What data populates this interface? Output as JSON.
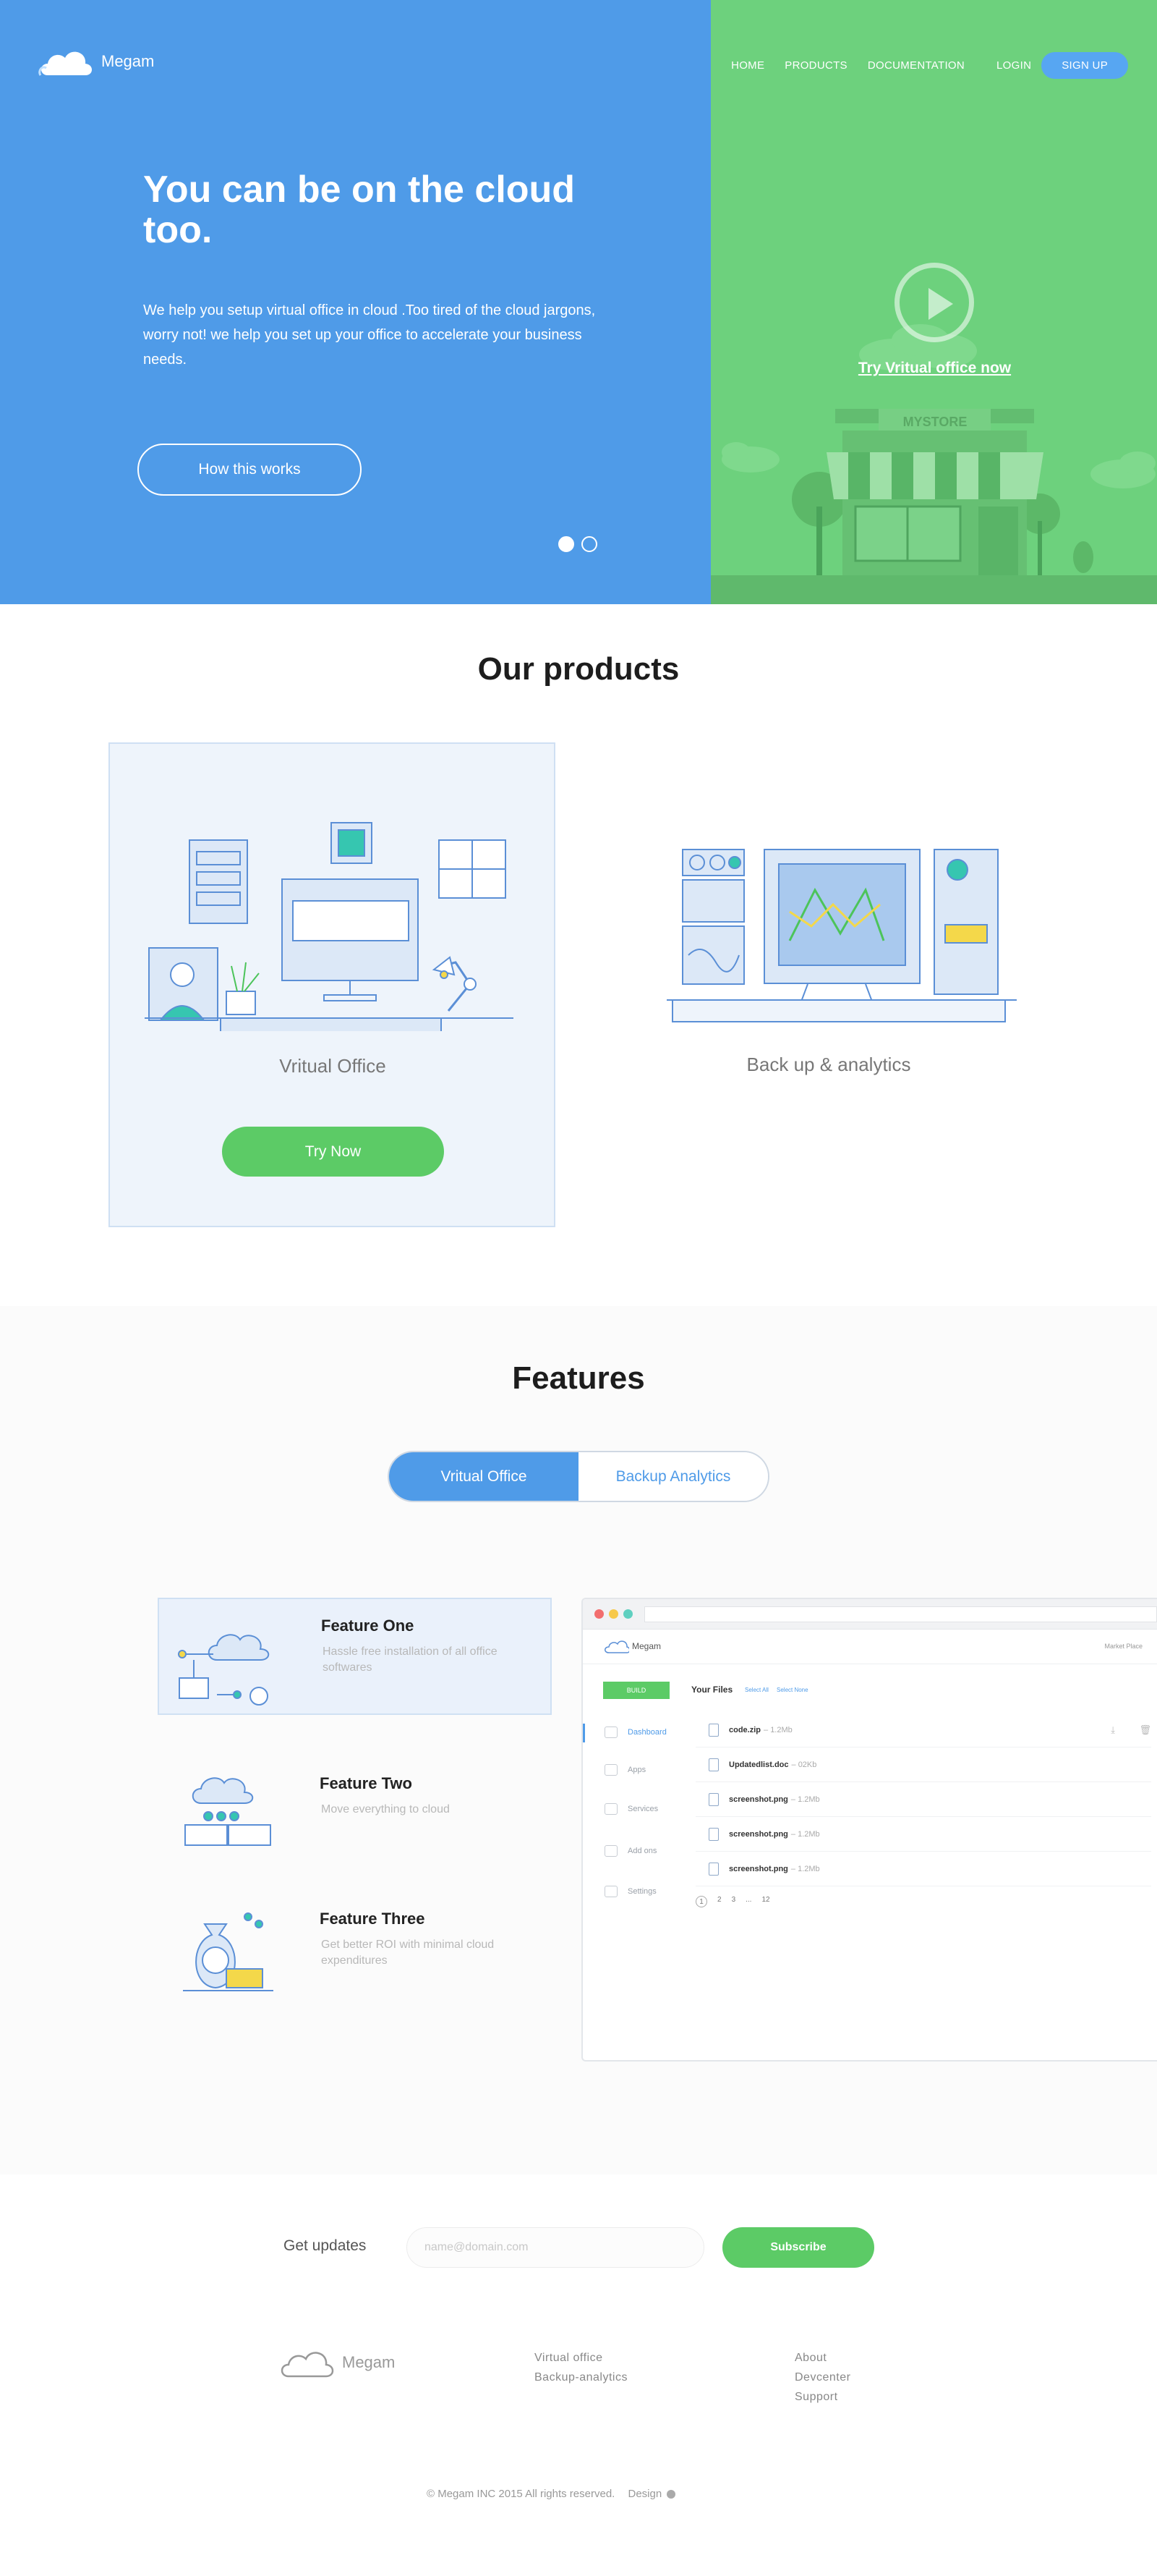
{
  "brand": {
    "name": "Megam"
  },
  "nav": {
    "home": "HOME",
    "products": "PRODUCTS",
    "documentation": "DOCUMENTATION",
    "login": "LOGIN",
    "signup": "SIGN UP"
  },
  "hero": {
    "title": "You can be on the cloud too.",
    "description": "We help you setup virtual office in cloud  .Too tired of the cloud jargons, worry not! we help you set up your office to accelerate your business needs.",
    "button": "How this works",
    "try_link": "Try Vritual office now",
    "store_sign": "MYSTORE",
    "slide_active": 1,
    "slide_count": 2
  },
  "products": {
    "title": "Our products",
    "items": [
      {
        "name": "Vritual Office",
        "button": "Try Now"
      },
      {
        "name": "Back up & analytics"
      }
    ]
  },
  "features": {
    "title": "Features",
    "tabs": [
      "Vritual Office",
      "Backup Analytics"
    ],
    "active_tab": 0,
    "items": [
      {
        "title": "Feature One",
        "desc": "Hassle free installation of all office softwares"
      },
      {
        "title": "Feature Two",
        "desc": "Move everything to cloud"
      },
      {
        "title": "Feature Three",
        "desc": "Get better ROI with minimal cloud expenditures"
      }
    ]
  },
  "app": {
    "brand": "Megam",
    "market": "Market Place",
    "build": "BUILD",
    "files_title": "Your Files",
    "select_all": "Select All",
    "select_none": "Select None",
    "sidebar": [
      "Dashboard",
      "Apps",
      "Services",
      "Add ons",
      "Settings"
    ],
    "files": [
      {
        "name": "code.zip",
        "size": "– 1.2Mb"
      },
      {
        "name": "Updatedlist.doc",
        "size": "– 02Kb"
      },
      {
        "name": "screenshot.png",
        "size": "– 1.2Mb"
      },
      {
        "name": "screenshot.png",
        "size": "– 1.2Mb"
      },
      {
        "name": "screenshot.png",
        "size": "– 1.2Mb"
      }
    ],
    "pagination": [
      "1",
      "2",
      "3",
      "...",
      "12"
    ]
  },
  "updates": {
    "label": "Get updates",
    "placeholder": "name@domain.com",
    "button": "Subscribe"
  },
  "footer": {
    "brand": "Megam",
    "col1": [
      "Virtual office",
      "Backup-analytics"
    ],
    "col2": [
      "About",
      "Devcenter",
      "Support"
    ],
    "copyright": "© Megam INC 2015  All rights reserved.",
    "design": "Design"
  },
  "colors": {
    "blue": "#4f9be8",
    "green": "#6dd17d",
    "button_green": "#5ccb66"
  }
}
